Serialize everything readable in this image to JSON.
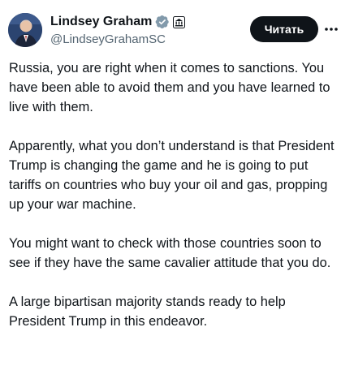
{
  "author": {
    "name": "Lindsey Graham",
    "handle": "@LindseyGrahamSC",
    "verified_icon": "verified-badge-icon",
    "affiliation_icon": "government-building-icon"
  },
  "actions": {
    "follow_label": "Читать",
    "more_icon": "more-dots-icon"
  },
  "tweet": {
    "paragraphs": [
      "Russia, you are right when it comes to sanctions. You have been able to avoid them and you have learned to live with them.",
      "Apparently, what you don’t understand is that President Trump is changing the game and he is going to put tariffs on countries who buy your oil and gas, propping up your war machine.",
      "You might want to check with those countries soon to see if they have the same cavalier attitude that you do.",
      "A large bipartisan majority stands ready to help President Trump in this endeavor."
    ]
  },
  "colors": {
    "text": "#0f1419",
    "secondary": "#536471",
    "verified": "#829aab",
    "button_bg": "#0f1419",
    "button_text": "#ffffff"
  }
}
